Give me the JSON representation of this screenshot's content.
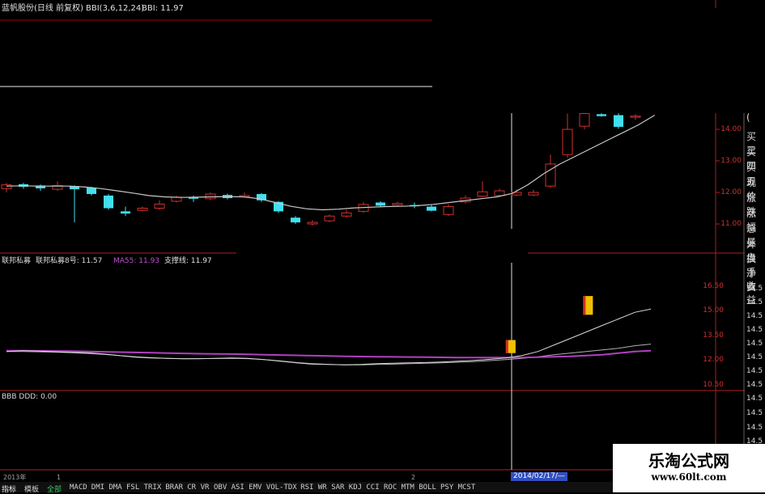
{
  "header": {
    "stock_title": "蓝帆股份(日线 前复权)",
    "indicator": "BBI(3,6,12,24)",
    "indicator_value": "BBI: 11.97"
  },
  "price_axis": [
    "14.00",
    "13.00",
    "12.00",
    "11.00"
  ],
  "right_panel": [
    "(",
    "买三",
    "买四",
    "买五",
    "现价",
    "涨跌",
    "涨幅",
    "总量",
    "外盘",
    "换手",
    "净资",
    "收益"
  ],
  "sub_panel": {
    "name1": "联邦私募",
    "name2": "联邦私募8号: 11.57",
    "ma": "MA55: 11.93",
    "support": "支撑线: 11.97",
    "axis": [
      "16.50",
      "15.00",
      "13.50",
      "12.00",
      "10.50"
    ],
    "axis_right": [
      "14.5",
      "14.5",
      "14.5",
      "14.5",
      "14.5",
      "14.5",
      "14.5",
      "14.5"
    ]
  },
  "bbb_panel": {
    "label": "BBB DDD: 0.00",
    "axis_right": [
      "14.5",
      "14.5",
      "14.5",
      "14.5"
    ]
  },
  "date_axis": {
    "year": "2013年",
    "tick1": "1",
    "tick2": "2",
    "cursor_date": "2014/02/17/—"
  },
  "tabs": [
    {
      "label": "指标",
      "active": true
    },
    {
      "label": "模板",
      "active": false
    },
    {
      "label": "全部",
      "green": true
    },
    {
      "label": "MACD"
    },
    {
      "label": "DMI"
    },
    {
      "label": "DMA"
    },
    {
      "label": "FSL"
    },
    {
      "label": "TRIX"
    },
    {
      "label": "BRAR"
    },
    {
      "label": "CR"
    },
    {
      "label": "VR"
    },
    {
      "label": "OBV"
    },
    {
      "label": "ASI"
    },
    {
      "label": "EMV"
    },
    {
      "label": "VOL-TDX"
    },
    {
      "label": "RSI"
    },
    {
      "label": "WR"
    },
    {
      "label": "SAR"
    },
    {
      "label": "KDJ"
    },
    {
      "label": "CCI"
    },
    {
      "label": "ROC"
    },
    {
      "label": "MTM"
    },
    {
      "label": "BOLL"
    },
    {
      "label": "PSY"
    },
    {
      "label": "MCST"
    }
  ],
  "watermark": {
    "line1": "乐淘公式网",
    "line2": "www.60lt.com"
  },
  "colors": {
    "up": "#d03030",
    "down": "#40e0f0",
    "ma_line": "#c8c8c8",
    "purple": "#b040c0",
    "gold": "#f0c000",
    "axis_red": "#b02020",
    "cursor": "#e0e0e0",
    "date_highlight": "#3050c0"
  },
  "chart_data": {
    "type": "candlestick",
    "candles": [
      {
        "o": 12.12,
        "c": 12.24,
        "h": 12.3,
        "l": 12.0
      },
      {
        "o": 12.26,
        "c": 12.18,
        "h": 12.3,
        "l": 12.12
      },
      {
        "o": 12.22,
        "c": 12.13,
        "h": 12.25,
        "l": 12.05
      },
      {
        "o": 12.1,
        "c": 12.22,
        "h": 12.35,
        "l": 12.05
      },
      {
        "o": 12.2,
        "c": 12.1,
        "h": 12.22,
        "l": 11.05
      },
      {
        "o": 12.15,
        "c": 11.95,
        "h": 12.18,
        "l": 11.9
      },
      {
        "o": 11.9,
        "c": 11.5,
        "h": 11.95,
        "l": 11.45
      },
      {
        "o": 11.4,
        "c": 11.33,
        "h": 11.55,
        "l": 11.25
      },
      {
        "o": 11.43,
        "c": 11.5,
        "h": 11.55,
        "l": 11.4
      },
      {
        "o": 11.5,
        "c": 11.63,
        "h": 11.75,
        "l": 11.45
      },
      {
        "o": 11.72,
        "c": 11.85,
        "h": 11.9,
        "l": 11.68
      },
      {
        "o": 11.85,
        "c": 11.8,
        "h": 11.9,
        "l": 11.7
      },
      {
        "o": 11.8,
        "c": 11.95,
        "h": 12.0,
        "l": 11.75
      },
      {
        "o": 11.92,
        "c": 11.82,
        "h": 11.96,
        "l": 11.78
      },
      {
        "o": 11.88,
        "c": 11.9,
        "h": 12.0,
        "l": 11.85
      },
      {
        "o": 11.95,
        "c": 11.75,
        "h": 11.98,
        "l": 11.7
      },
      {
        "o": 11.7,
        "c": 11.4,
        "h": 11.72,
        "l": 11.35
      },
      {
        "o": 11.2,
        "c": 11.05,
        "h": 11.25,
        "l": 11.0
      },
      {
        "o": 11.0,
        "c": 11.05,
        "h": 11.12,
        "l": 10.95
      },
      {
        "o": 11.1,
        "c": 11.25,
        "h": 11.3,
        "l": 11.05
      },
      {
        "o": 11.25,
        "c": 11.35,
        "h": 11.45,
        "l": 11.2
      },
      {
        "o": 11.4,
        "c": 11.62,
        "h": 11.7,
        "l": 11.35
      },
      {
        "o": 11.68,
        "c": 11.58,
        "h": 11.72,
        "l": 11.55
      },
      {
        "o": 11.6,
        "c": 11.65,
        "h": 11.7,
        "l": 11.55
      },
      {
        "o": 11.6,
        "c": 11.58,
        "h": 11.68,
        "l": 11.5
      },
      {
        "o": 11.55,
        "c": 11.42,
        "h": 11.6,
        "l": 11.4
      },
      {
        "o": 11.3,
        "c": 11.55,
        "h": 11.62,
        "l": 11.25
      },
      {
        "o": 11.7,
        "c": 11.82,
        "h": 11.9,
        "l": 11.65
      },
      {
        "o": 11.88,
        "c": 12.02,
        "h": 12.35,
        "l": 11.85
      },
      {
        "o": 11.9,
        "c": 12.05,
        "h": 12.12,
        "l": 11.85
      },
      {
        "o": 11.92,
        "c": 12.0,
        "h": 12.1,
        "l": 11.88
      },
      {
        "o": 11.92,
        "c": 12.0,
        "h": 12.08,
        "l": 11.88
      },
      {
        "o": 12.2,
        "c": 12.9,
        "h": 13.2,
        "l": 12.15
      },
      {
        "o": 13.2,
        "c": 14.0,
        "h": 14.5,
        "l": 13.1
      },
      {
        "o": 14.1,
        "c": 14.5,
        "h": 14.6,
        "l": 14.0
      },
      {
        "o": 14.48,
        "c": 14.42,
        "h": 14.6,
        "l": 14.4
      },
      {
        "o": 14.45,
        "c": 14.08,
        "h": 14.55,
        "l": 14.02
      },
      {
        "o": 14.4,
        "c": 14.42,
        "h": 14.48,
        "l": 14.3
      }
    ],
    "bbi": [
      12.2,
      12.21,
      12.2,
      12.2,
      12.2,
      12.17,
      12.12,
      12.05,
      11.98,
      11.9,
      11.86,
      11.84,
      11.85,
      11.86,
      11.87,
      11.86,
      11.8,
      11.68,
      11.56,
      11.48,
      11.45,
      11.47,
      11.51,
      11.53,
      11.55,
      11.56,
      11.58,
      11.62,
      11.68,
      11.74,
      11.8,
      11.86,
      11.97,
      12.25,
      12.6,
      12.9,
      13.15,
      13.4,
      13.65,
      13.9,
      14.15,
      14.45
    ],
    "sub_lines": {
      "white": [
        12.3,
        12.35,
        12.32,
        12.28,
        12.25,
        12.22,
        12.15,
        12.05,
        11.95,
        11.9,
        11.88,
        11.85,
        11.86,
        11.88,
        11.9,
        11.88,
        11.8,
        11.7,
        11.6,
        11.52,
        11.5,
        11.48,
        11.5,
        11.55,
        11.58,
        11.6,
        11.62,
        11.65,
        11.7,
        11.75,
        11.82,
        11.9,
        12.05,
        12.3,
        12.7,
        13.1,
        13.5,
        13.9,
        14.3,
        14.7,
        14.9
      ],
      "purple": [
        12.35,
        12.35,
        12.34,
        12.33,
        12.32,
        12.3,
        12.28,
        12.26,
        12.24,
        12.22,
        12.2,
        12.18,
        12.16,
        12.15,
        12.14,
        12.12,
        12.1,
        12.08,
        12.06,
        12.04,
        12.02,
        12.0,
        11.99,
        11.98,
        11.97,
        11.96,
        11.95,
        11.94,
        11.93,
        11.93,
        11.93,
        11.93,
        11.93,
        11.95,
        11.98,
        12.0,
        12.05,
        12.1,
        12.2,
        12.3,
        12.35
      ],
      "gray": [
        12.3,
        12.3,
        12.28,
        12.26,
        12.22,
        12.18,
        12.12,
        12.05,
        11.98,
        11.92,
        11.88,
        11.86,
        11.86,
        11.87,
        11.88,
        11.86,
        11.8,
        11.72,
        11.62,
        11.55,
        11.5,
        11.48,
        11.48,
        11.5,
        11.52,
        11.55,
        11.58,
        11.6,
        11.64,
        11.68,
        11.74,
        11.8,
        11.88,
        11.98,
        12.1,
        12.2,
        12.3,
        12.4,
        12.5,
        12.65,
        12.75
      ]
    },
    "markers": [
      {
        "x": 31.3,
        "low": 12.2,
        "high": 13.0
      },
      {
        "x": 36.1,
        "low": 14.55,
        "high": 15.7
      }
    ],
    "price_range": [
      10.6,
      15.1
    ],
    "sub_range": [
      10.2,
      17.4
    ]
  }
}
